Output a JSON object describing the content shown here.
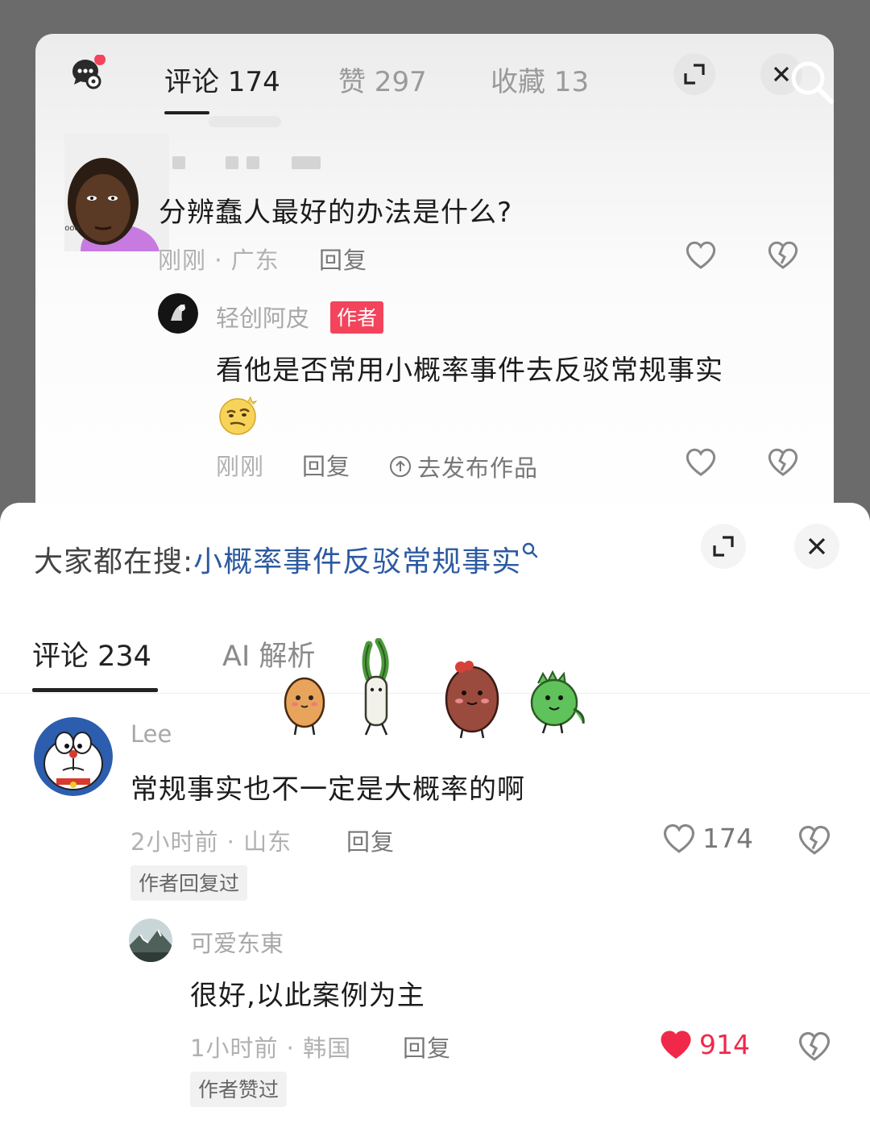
{
  "top_panel": {
    "tabs": [
      {
        "label": "评论 174",
        "active": true
      },
      {
        "label": "赞 297",
        "active": false
      },
      {
        "label": "收藏 13",
        "active": false
      }
    ],
    "comment": {
      "text": "分辨蠢人最好的办法是什么?",
      "meta": "刚刚 · 广东",
      "reply_label": "回复"
    },
    "reply": {
      "username": "轻创阿皮",
      "badge": "作者",
      "text": "看他是否常用小概率事件去反驳常规事实",
      "meta": "刚刚",
      "reply_label": "回复",
      "publish_label": "去发布作品"
    }
  },
  "sheet": {
    "search_prefix": "大家都在搜:",
    "search_query": "小概率事件反驳常规事实",
    "tabs": [
      {
        "label": "评论 234",
        "active": true
      },
      {
        "label": "AI 解析",
        "active": false
      }
    ],
    "comments": [
      {
        "username": "Lee",
        "text": "常规事实也不一定是大概率的啊",
        "meta": "2小时前 · 山东",
        "reply_label": "回复",
        "likes": "174",
        "liked": false,
        "tag": "作者回复过"
      },
      {
        "username": "可爱东東",
        "text": "很好,以此案例为主",
        "meta": "1小时前 · 韩国",
        "reply_label": "回复",
        "likes": "914",
        "liked": true,
        "tag": "作者赞过"
      }
    ]
  },
  "colors": {
    "accent_red": "#f0284a",
    "badge_red": "#f3445c",
    "link_blue": "#2c5aa0",
    "icons": [
      "chat-settings-icon",
      "expand-icon",
      "close-icon",
      "search-icon",
      "heart-icon",
      "dislike-heart-icon",
      "upload-icon"
    ]
  }
}
